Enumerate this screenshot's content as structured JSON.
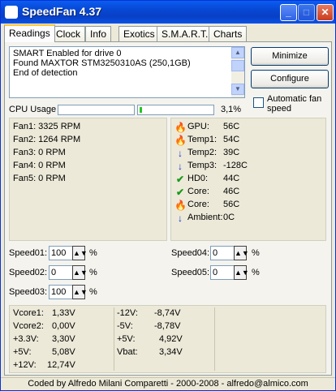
{
  "window": {
    "title": "SpeedFan 4.37"
  },
  "tabs": [
    {
      "label": "Readings"
    },
    {
      "label": "Clock"
    },
    {
      "label": "Info"
    },
    {
      "label": "Exotics"
    },
    {
      "label": "S.M.A.R.T."
    },
    {
      "label": "Charts"
    }
  ],
  "log": {
    "lines": [
      "SMART Enabled for drive 0",
      "Found MAXTOR STM3250310AS (250,1GB)",
      "End of detection"
    ]
  },
  "buttons": {
    "minimize": "Minimize",
    "configure": "Configure"
  },
  "auto_fan": {
    "label_line1": "Automatic fan",
    "label_line2": "speed",
    "checked": false
  },
  "cpu": {
    "label": "CPU Usage",
    "value": "3,1%",
    "bar1_fraction": 0.0,
    "bar2_fraction": 0.03
  },
  "fans": [
    {
      "text": "Fan1: 3325 RPM"
    },
    {
      "text": "Fan2: 1264 RPM"
    },
    {
      "text": "Fan3: 0 RPM"
    },
    {
      "text": "Fan4: 0 RPM"
    },
    {
      "text": "Fan5: 0 RPM"
    }
  ],
  "temps": [
    {
      "icon": "flame-icon",
      "name": "GPU:",
      "value": "56C"
    },
    {
      "icon": "flame-icon",
      "name": "Temp1:",
      "value": "54C"
    },
    {
      "icon": "down-arrow-icon",
      "name": "Temp2:",
      "value": "39C"
    },
    {
      "icon": "down-arrow-icon",
      "name": "Temp3:",
      "value": "-128C"
    },
    {
      "icon": "checkmark-icon",
      "name": "HD0:",
      "value": "44C"
    },
    {
      "icon": "checkmark-icon",
      "name": "Core:",
      "value": "46C"
    },
    {
      "icon": "flame-icon",
      "name": "Core:",
      "value": "56C"
    },
    {
      "icon": "down-arrow-icon",
      "name": "Ambient:",
      "value": "0C"
    }
  ],
  "speeds": [
    {
      "label": "Speed01:",
      "value": "100",
      "unit": "%"
    },
    {
      "label": "Speed02:",
      "value": "0",
      "unit": "%"
    },
    {
      "label": "Speed03:",
      "value": "100",
      "unit": "%"
    },
    {
      "label": "Speed04:",
      "value": "0",
      "unit": "%"
    },
    {
      "label": "Speed05:",
      "value": "0",
      "unit": "%"
    }
  ],
  "voltages_left": [
    {
      "name": "Vcore1:",
      "value": "1,33V"
    },
    {
      "name": "Vcore2:",
      "value": "0,00V"
    },
    {
      "name": "+3.3V:",
      "value": "3,30V"
    },
    {
      "name": "+5V:",
      "value": "5,08V"
    },
    {
      "name": "+12V:",
      "value": "12,74V"
    }
  ],
  "voltages_right": [
    {
      "name": "-12V:",
      "value": "-8,74V"
    },
    {
      "name": "-5V:",
      "value": "-8,78V"
    },
    {
      "name": "+5V:",
      "value": "4,92V"
    },
    {
      "name": "Vbat:",
      "value": "3,34V"
    }
  ],
  "footer": {
    "text": "Coded by Alfredo Milani Comparetti - 2000-2008 - alfredo@almico.com"
  },
  "colors": {
    "titlebar": "#0A5DF0",
    "bar_fill": "#22C722",
    "flame": "#E84A10",
    "down": "#1030D0",
    "ok": "#1A9A1A"
  }
}
